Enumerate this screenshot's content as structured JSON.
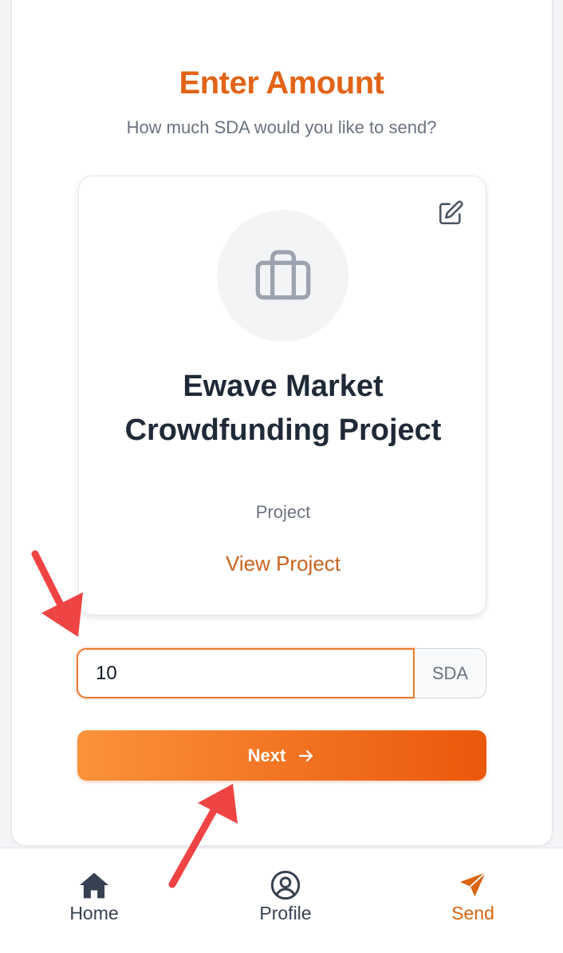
{
  "header": {
    "title": "Enter Amount",
    "subtitle": "How much SDA would you like to send?"
  },
  "card": {
    "edit_icon": "pencil-square-icon",
    "avatar_icon": "briefcase-icon",
    "project_name": "Ewave Market Crowdfunding Project",
    "project_type": "Project",
    "view_link": "View Project"
  },
  "amount": {
    "value": "10",
    "unit": "SDA"
  },
  "next_button": {
    "label": "Next",
    "icon": "arrow-right-icon"
  },
  "bottom_nav": {
    "items": [
      {
        "label": "Home",
        "icon": "home-icon",
        "active": false
      },
      {
        "label": "Profile",
        "icon": "user-circle-icon",
        "active": false
      },
      {
        "label": "Send",
        "icon": "paper-plane-icon",
        "active": true
      }
    ]
  },
  "colors": {
    "accent": "#e26417",
    "button_start": "#fb923c",
    "button_end": "#ea580c",
    "annotation": "#ef4444"
  }
}
